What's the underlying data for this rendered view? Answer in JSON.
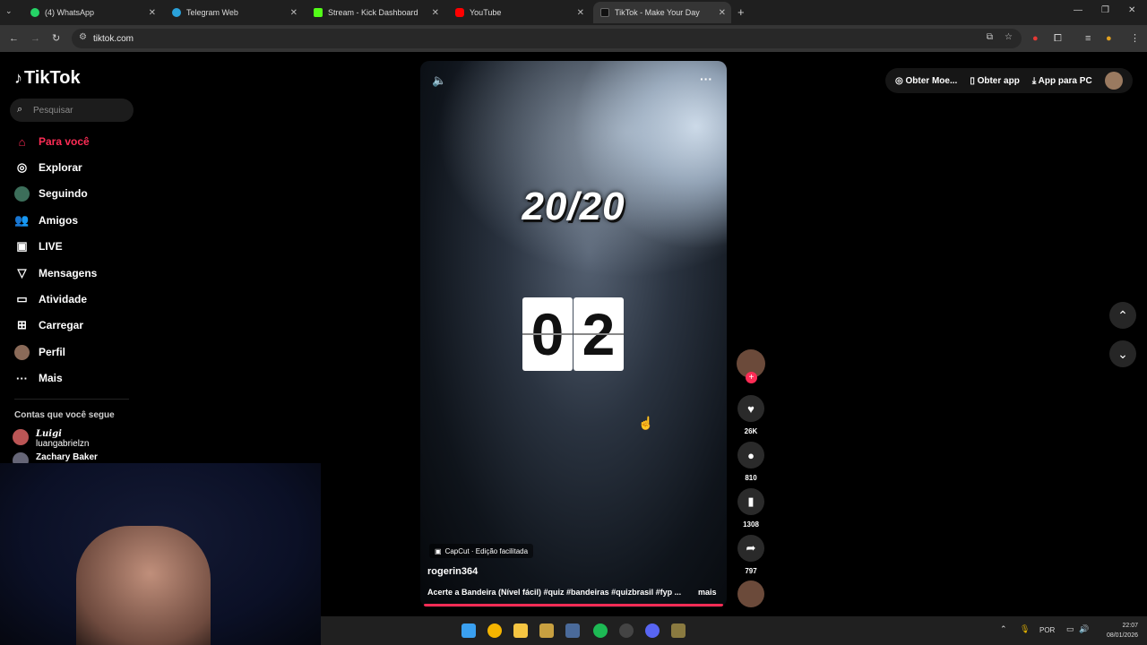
{
  "browser": {
    "tabs": [
      {
        "title": "(4) WhatsApp",
        "icon": "whatsapp-icon"
      },
      {
        "title": "Telegram Web",
        "icon": "telegram-icon"
      },
      {
        "title": "Stream - Kick Dashboard",
        "icon": "kick-icon"
      },
      {
        "title": "YouTube",
        "icon": "youtube-icon"
      },
      {
        "title": "TikTok - Make Your Day",
        "icon": "tiktok-icon"
      }
    ],
    "url": "tiktok.com"
  },
  "sidebar": {
    "logo": "TikTok",
    "search_placeholder": "Pesquisar",
    "nav": [
      {
        "label": "Para você",
        "icon": "home-icon"
      },
      {
        "label": "Explorar",
        "icon": "compass-icon"
      },
      {
        "label": "Seguindo",
        "icon": "following-icon"
      },
      {
        "label": "Amigos",
        "icon": "friends-icon"
      },
      {
        "label": "LIVE",
        "icon": "live-icon"
      },
      {
        "label": "Mensagens",
        "icon": "messages-icon"
      },
      {
        "label": "Atividade",
        "icon": "activity-icon"
      },
      {
        "label": "Carregar",
        "icon": "upload-icon"
      },
      {
        "label": "Perfil",
        "icon": "profile-icon"
      },
      {
        "label": "Mais",
        "icon": "more-icon"
      }
    ],
    "following_title": "Contas que você segue",
    "following": [
      {
        "name": "Luigi",
        "handle": "luangabrielzn"
      },
      {
        "name": "Zachary Baker",
        "handle": ""
      }
    ]
  },
  "video": {
    "score": "20/20",
    "timer": [
      "0",
      "2"
    ],
    "capcut": "CapCut · Edição facilitada",
    "username": "rogerin364",
    "caption": "Acerte a Bandeira (Nível fácil)  #quiz #bandeiras #quizbrasil #fyp ...",
    "more": "mais",
    "progress": 1.0
  },
  "actions": [
    {
      "icon": "heart-icon",
      "count": "26K"
    },
    {
      "icon": "comment-icon",
      "count": "810"
    },
    {
      "icon": "bookmark-icon",
      "count": "1308"
    },
    {
      "icon": "share-icon",
      "count": "797"
    }
  ],
  "topbar": {
    "coins": "Obter Moe...",
    "get_app": "Obter app",
    "pc_app": "App para PC"
  },
  "taskbar": {
    "lang": "POR",
    "time": "22:07",
    "date": "08/01/2026"
  },
  "colors": {
    "accent": "#fe2c55"
  }
}
